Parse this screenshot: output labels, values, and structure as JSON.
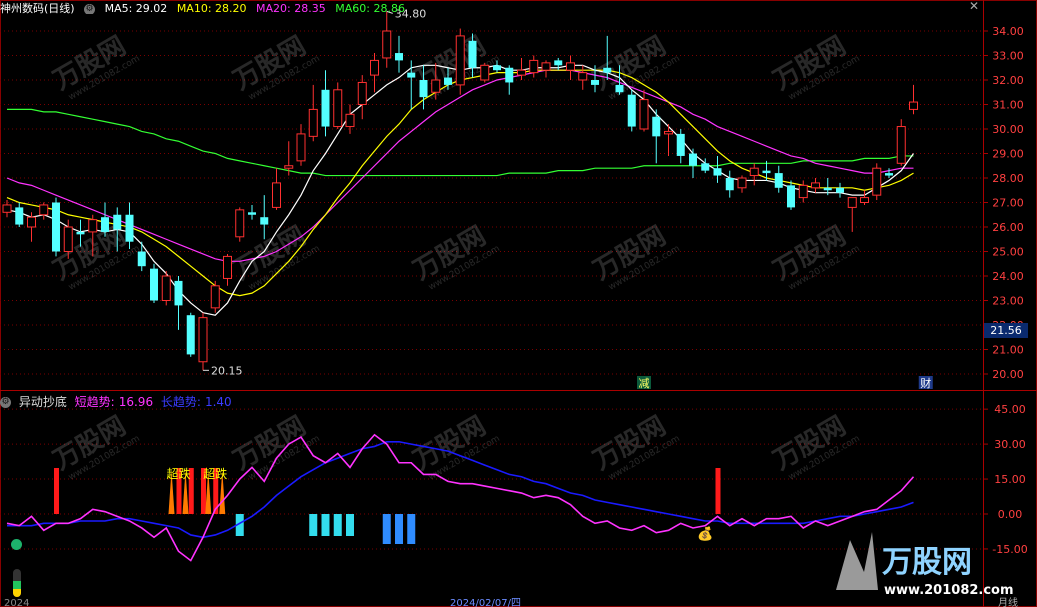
{
  "header": {
    "title": "神州数码(日线)",
    "ma": [
      {
        "label": "MA5: 29.02",
        "color": "#ffffff"
      },
      {
        "label": "MA10: 28.20",
        "color": "#ffff00"
      },
      {
        "label": "MA20: 28.35",
        "color": "#ff33ff"
      },
      {
        "label": "MA60: 28.86",
        "color": "#33ff33"
      }
    ]
  },
  "price_axis": {
    "ticks": [
      "34.00",
      "33.00",
      "32.00",
      "31.00",
      "30.00",
      "29.00",
      "28.00",
      "27.00",
      "26.00",
      "25.00",
      "24.00",
      "23.00",
      "22.00",
      "21.00",
      "20.00"
    ],
    "current_price": "21.56",
    "high_label": "34.80",
    "low_label": "20.15",
    "marker_jian": "减",
    "marker_cai": "财"
  },
  "indicator": {
    "name": "异动抄底",
    "short_label": "短趋势:",
    "short_value": "16.96",
    "long_label": "长趋势:",
    "long_value": "1.40",
    "ticks": [
      "45.00",
      "30.00",
      "15.00",
      "0.00",
      "-15.00"
    ],
    "signal_label": "超跌"
  },
  "footer": {
    "date_fragment": "2024/02/07/四",
    "left_fragment": "2024",
    "right_fragment": "月线"
  },
  "watermark": {
    "brand": "万股网",
    "url": "www.201082.com"
  },
  "colors": {
    "up": "#ff3030",
    "down": "#54ffff",
    "ma5": "#ffffff",
    "ma10": "#ffff00",
    "ma20": "#ff33ff",
    "ma60": "#33ff33",
    "short_trend": "#ff33ff",
    "long_trend": "#1a1aff",
    "grid": "#7a0000"
  },
  "chart_data": {
    "type": "candlestick",
    "candles": [
      {
        "o": 26.6,
        "h": 27.1,
        "l": 26.4,
        "c": 26.9
      },
      {
        "o": 26.8,
        "h": 27.0,
        "l": 26.0,
        "c": 26.1
      },
      {
        "o": 26.0,
        "h": 26.6,
        "l": 25.4,
        "c": 26.4
      },
      {
        "o": 26.5,
        "h": 27.0,
        "l": 26.3,
        "c": 26.9
      },
      {
        "o": 27.0,
        "h": 27.2,
        "l": 24.8,
        "c": 25.0
      },
      {
        "o": 25.0,
        "h": 26.3,
        "l": 24.7,
        "c": 26.0
      },
      {
        "o": 25.8,
        "h": 26.3,
        "l": 25.2,
        "c": 25.7
      },
      {
        "o": 25.8,
        "h": 26.5,
        "l": 24.8,
        "c": 26.3
      },
      {
        "o": 26.4,
        "h": 27.0,
        "l": 25.6,
        "c": 25.8
      },
      {
        "o": 26.5,
        "h": 26.8,
        "l": 25.0,
        "c": 25.9
      },
      {
        "o": 26.5,
        "h": 27.0,
        "l": 25.1,
        "c": 25.4
      },
      {
        "o": 25.0,
        "h": 25.4,
        "l": 24.2,
        "c": 24.4
      },
      {
        "o": 24.3,
        "h": 24.5,
        "l": 22.9,
        "c": 23.0
      },
      {
        "o": 23.0,
        "h": 24.2,
        "l": 22.8,
        "c": 24.0
      },
      {
        "o": 23.8,
        "h": 24.0,
        "l": 21.8,
        "c": 22.8
      },
      {
        "o": 22.4,
        "h": 22.5,
        "l": 20.7,
        "c": 20.8
      },
      {
        "o": 20.5,
        "h": 22.5,
        "l": 20.15,
        "c": 22.3
      },
      {
        "o": 22.7,
        "h": 23.8,
        "l": 22.5,
        "c": 23.6
      },
      {
        "o": 23.9,
        "h": 24.9,
        "l": 23.6,
        "c": 24.8
      },
      {
        "o": 25.6,
        "h": 26.8,
        "l": 25.4,
        "c": 26.7
      },
      {
        "o": 26.6,
        "h": 26.9,
        "l": 26.3,
        "c": 26.5
      },
      {
        "o": 26.4,
        "h": 27.3,
        "l": 25.5,
        "c": 26.1
      },
      {
        "o": 26.8,
        "h": 28.4,
        "l": 26.7,
        "c": 27.8
      },
      {
        "o": 28.4,
        "h": 29.5,
        "l": 28.1,
        "c": 28.5
      },
      {
        "o": 28.7,
        "h": 30.2,
        "l": 28.5,
        "c": 29.8
      },
      {
        "o": 29.7,
        "h": 31.8,
        "l": 29.5,
        "c": 30.8
      },
      {
        "o": 31.6,
        "h": 32.4,
        "l": 29.7,
        "c": 30.1
      },
      {
        "o": 30.1,
        "h": 31.9,
        "l": 30.0,
        "c": 31.6
      },
      {
        "o": 30.1,
        "h": 31.0,
        "l": 29.8,
        "c": 30.6
      },
      {
        "o": 31.0,
        "h": 32.2,
        "l": 30.4,
        "c": 31.9
      },
      {
        "o": 32.2,
        "h": 33.1,
        "l": 31.5,
        "c": 32.8
      },
      {
        "o": 32.9,
        "h": 34.8,
        "l": 32.5,
        "c": 34.0
      },
      {
        "o": 33.1,
        "h": 33.8,
        "l": 32.3,
        "c": 32.8
      },
      {
        "o": 32.3,
        "h": 32.8,
        "l": 30.8,
        "c": 32.1
      },
      {
        "o": 32.0,
        "h": 32.6,
        "l": 30.8,
        "c": 31.3
      },
      {
        "o": 31.5,
        "h": 32.7,
        "l": 31.2,
        "c": 32.0
      },
      {
        "o": 32.1,
        "h": 32.5,
        "l": 31.6,
        "c": 31.8
      },
      {
        "o": 31.8,
        "h": 34.1,
        "l": 31.4,
        "c": 33.8
      },
      {
        "o": 33.6,
        "h": 33.9,
        "l": 32.1,
        "c": 32.5
      },
      {
        "o": 32.0,
        "h": 32.7,
        "l": 31.9,
        "c": 32.6
      },
      {
        "o": 32.6,
        "h": 32.8,
        "l": 32.3,
        "c": 32.4
      },
      {
        "o": 32.5,
        "h": 32.6,
        "l": 31.4,
        "c": 31.9
      },
      {
        "o": 32.2,
        "h": 32.9,
        "l": 32.0,
        "c": 32.4
      },
      {
        "o": 32.3,
        "h": 33.0,
        "l": 32.1,
        "c": 32.8
      },
      {
        "o": 32.4,
        "h": 32.8,
        "l": 32.1,
        "c": 32.7
      },
      {
        "o": 32.8,
        "h": 32.9,
        "l": 32.4,
        "c": 32.6
      },
      {
        "o": 32.4,
        "h": 33.0,
        "l": 32.0,
        "c": 32.7
      },
      {
        "o": 32.0,
        "h": 32.6,
        "l": 31.6,
        "c": 32.3
      },
      {
        "o": 32.0,
        "h": 32.6,
        "l": 31.5,
        "c": 31.8
      },
      {
        "o": 32.5,
        "h": 33.8,
        "l": 32.0,
        "c": 32.3
      },
      {
        "o": 31.8,
        "h": 32.6,
        "l": 31.4,
        "c": 31.5
      },
      {
        "o": 31.4,
        "h": 31.6,
        "l": 29.9,
        "c": 30.1
      },
      {
        "o": 30.0,
        "h": 31.6,
        "l": 29.9,
        "c": 31.2
      },
      {
        "o": 30.5,
        "h": 30.8,
        "l": 28.6,
        "c": 29.7
      },
      {
        "o": 29.8,
        "h": 30.2,
        "l": 28.9,
        "c": 29.9
      },
      {
        "o": 29.8,
        "h": 30.0,
        "l": 28.6,
        "c": 28.9
      },
      {
        "o": 29.0,
        "h": 29.2,
        "l": 28.0,
        "c": 28.5
      },
      {
        "o": 28.6,
        "h": 28.8,
        "l": 28.2,
        "c": 28.3
      },
      {
        "o": 28.4,
        "h": 28.9,
        "l": 27.8,
        "c": 28.1
      },
      {
        "o": 28.0,
        "h": 28.3,
        "l": 27.2,
        "c": 27.5
      },
      {
        "o": 27.6,
        "h": 28.1,
        "l": 27.4,
        "c": 28.0
      },
      {
        "o": 28.1,
        "h": 28.6,
        "l": 27.7,
        "c": 28.4
      },
      {
        "o": 28.3,
        "h": 28.7,
        "l": 27.9,
        "c": 28.2
      },
      {
        "o": 28.2,
        "h": 28.5,
        "l": 27.4,
        "c": 27.6
      },
      {
        "o": 27.7,
        "h": 27.9,
        "l": 26.7,
        "c": 26.8
      },
      {
        "o": 27.2,
        "h": 27.9,
        "l": 27.0,
        "c": 27.7
      },
      {
        "o": 27.6,
        "h": 28.0,
        "l": 27.4,
        "c": 27.8
      },
      {
        "o": 27.6,
        "h": 28.0,
        "l": 27.3,
        "c": 27.5
      },
      {
        "o": 27.6,
        "h": 27.8,
        "l": 27.2,
        "c": 27.4
      },
      {
        "o": 26.8,
        "h": 27.2,
        "l": 25.8,
        "c": 27.2
      },
      {
        "o": 27.0,
        "h": 27.5,
        "l": 26.9,
        "c": 27.2
      },
      {
        "o": 27.3,
        "h": 28.6,
        "l": 27.1,
        "c": 28.4
      },
      {
        "o": 28.2,
        "h": 28.4,
        "l": 28.0,
        "c": 28.1
      },
      {
        "o": 28.6,
        "h": 30.4,
        "l": 28.5,
        "c": 30.1
      },
      {
        "o": 30.8,
        "h": 31.8,
        "l": 30.6,
        "c": 31.1
      }
    ],
    "ma5": [
      26.7,
      26.6,
      26.4,
      26.5,
      26.3,
      26.0,
      25.8,
      25.9,
      25.8,
      25.9,
      25.8,
      25.3,
      24.6,
      24.1,
      23.4,
      22.9,
      22.5,
      22.4,
      22.9,
      23.8,
      24.6,
      25.0,
      25.8,
      26.5,
      27.3,
      28.3,
      29.0,
      29.8,
      30.6,
      31.0,
      31.4,
      31.8,
      32.1,
      32.5,
      32.6,
      32.6,
      32.5,
      32.4,
      32.5,
      32.5,
      32.6,
      32.4,
      32.4,
      32.5,
      32.5,
      32.5,
      32.6,
      32.6,
      32.4,
      32.3,
      32.1,
      31.6,
      31.2,
      30.6,
      30.1,
      29.6,
      29.0,
      28.6,
      28.3,
      28.0,
      27.9,
      27.9,
      27.9,
      27.8,
      27.6,
      27.5,
      27.4,
      27.4,
      27.4,
      27.3,
      27.3,
      27.6,
      27.9,
      28.3,
      29.0
    ],
    "ma10": [
      27.2,
      27.0,
      26.9,
      26.8,
      26.7,
      26.5,
      26.4,
      26.3,
      26.2,
      26.1,
      26.0,
      25.8,
      25.5,
      25.2,
      24.8,
      24.4,
      24.0,
      23.6,
      23.3,
      23.2,
      23.3,
      23.6,
      24.1,
      24.6,
      25.2,
      25.9,
      26.5,
      27.2,
      27.8,
      28.5,
      29.1,
      29.7,
      30.2,
      30.8,
      31.2,
      31.5,
      31.8,
      32.0,
      32.1,
      32.2,
      32.3,
      32.3,
      32.3,
      32.4,
      32.4,
      32.4,
      32.4,
      32.4,
      32.4,
      32.4,
      32.3,
      32.1,
      31.8,
      31.5,
      31.1,
      30.6,
      30.1,
      29.6,
      29.1,
      28.7,
      28.4,
      28.2,
      28.0,
      27.9,
      27.8,
      27.7,
      27.6,
      27.6,
      27.6,
      27.6,
      27.5,
      27.6,
      27.7,
      27.9,
      28.2
    ],
    "ma20": [
      28.0,
      27.8,
      27.7,
      27.5,
      27.3,
      27.1,
      26.9,
      26.7,
      26.5,
      26.3,
      26.1,
      25.9,
      25.7,
      25.5,
      25.3,
      25.1,
      24.9,
      24.7,
      24.6,
      24.6,
      24.7,
      24.8,
      25.0,
      25.3,
      25.6,
      26.0,
      26.5,
      27.0,
      27.5,
      28.0,
      28.5,
      29.0,
      29.5,
      29.9,
      30.3,
      30.7,
      31.0,
      31.3,
      31.6,
      31.8,
      32.0,
      32.1,
      32.2,
      32.3,
      32.4,
      32.4,
      32.4,
      32.3,
      32.2,
      32.1,
      31.9,
      31.7,
      31.5,
      31.3,
      31.1,
      30.9,
      30.6,
      30.4,
      30.1,
      29.9,
      29.7,
      29.5,
      29.3,
      29.1,
      28.9,
      28.8,
      28.6,
      28.5,
      28.4,
      28.3,
      28.2,
      28.2,
      28.3,
      28.4,
      28.4
    ],
    "ma60": [
      30.8,
      30.8,
      30.8,
      30.7,
      30.7,
      30.6,
      30.5,
      30.4,
      30.3,
      30.2,
      30.1,
      29.9,
      29.8,
      29.6,
      29.5,
      29.3,
      29.1,
      29.0,
      28.8,
      28.7,
      28.6,
      28.5,
      28.4,
      28.3,
      28.2,
      28.2,
      28.1,
      28.1,
      28.1,
      28.1,
      28.1,
      28.1,
      28.1,
      28.1,
      28.1,
      28.1,
      28.1,
      28.1,
      28.1,
      28.1,
      28.1,
      28.2,
      28.2,
      28.2,
      28.2,
      28.3,
      28.3,
      28.3,
      28.4,
      28.4,
      28.4,
      28.4,
      28.5,
      28.5,
      28.5,
      28.5,
      28.5,
      28.5,
      28.5,
      28.6,
      28.6,
      28.6,
      28.6,
      28.6,
      28.6,
      28.7,
      28.7,
      28.7,
      28.7,
      28.7,
      28.8,
      28.8,
      28.8,
      28.9,
      28.9
    ],
    "short_trend": [
      -4,
      -5,
      -1,
      -7,
      -4,
      -4,
      -2,
      2,
      1,
      -1,
      -3,
      -6,
      -10,
      -6,
      -16,
      -20,
      -10,
      2,
      8,
      15,
      20,
      14,
      24,
      30,
      33,
      25,
      22,
      26,
      20,
      28,
      34,
      30,
      22,
      22,
      17,
      17,
      14,
      13,
      13,
      12,
      11,
      10,
      9,
      7,
      8,
      7,
      4,
      -1,
      -4,
      -3,
      -6,
      -7,
      -5,
      -8,
      -7,
      -4,
      -6,
      -5,
      -1,
      -5,
      -2,
      -5,
      -2,
      -2,
      -1,
      -6,
      -3,
      -5,
      -3,
      -1,
      1,
      2,
      6,
      10,
      16
    ],
    "long_trend": [
      -5,
      -5,
      -5,
      -4,
      -4,
      -4,
      -3,
      -3,
      -3,
      -2,
      -2,
      -3,
      -4,
      -5,
      -6,
      -9,
      -10,
      -9,
      -7,
      -4,
      -1,
      3,
      8,
      12,
      16,
      19,
      22,
      24,
      26,
      28,
      29,
      31,
      31,
      30,
      29,
      28,
      27,
      25,
      23,
      21,
      19,
      17,
      16,
      14,
      13,
      11,
      9,
      8,
      6,
      5,
      4,
      3,
      2,
      1,
      0,
      -1,
      -2,
      -3,
      -3,
      -4,
      -4,
      -4,
      -4,
      -4,
      -4,
      -4,
      -3,
      -2,
      -1,
      -1,
      0,
      1,
      2,
      3,
      5
    ],
    "red_signal_bars": [
      4,
      14,
      15,
      16,
      17,
      58
    ],
    "chaodie_bars": [
      14,
      17
    ],
    "cyan_signal_bars": [
      19,
      25,
      26,
      27,
      28,
      31,
      32,
      33
    ]
  }
}
